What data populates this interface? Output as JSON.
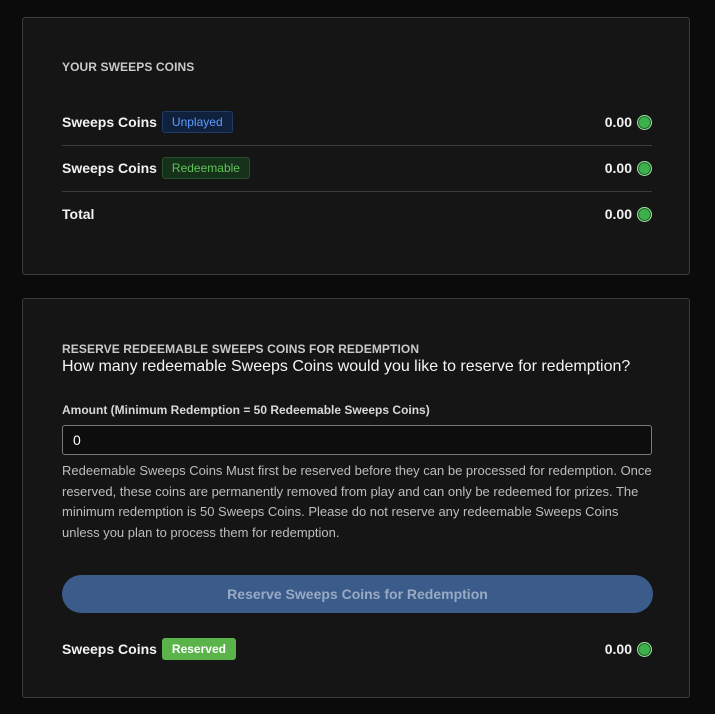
{
  "balances": {
    "title": "YOUR SWEEPS COINS",
    "rows": [
      {
        "label": "Sweeps Coins",
        "badge": "Unplayed",
        "amount": "0.00"
      },
      {
        "label": "Sweeps Coins",
        "badge": "Redeemable",
        "amount": "0.00"
      },
      {
        "label": "Total",
        "amount": "0.00"
      }
    ],
    "coin_color": "#3cb04a"
  },
  "reserve": {
    "title": "RESERVE REDEEMABLE SWEEPS COINS FOR REDEMPTION",
    "question": "How many redeemable Sweeps Coins would you like to reserve for redemption?",
    "amount_label": "Amount (Minimum Redemption = 50 Redeemable Sweeps Coins)",
    "amount_value": "0",
    "help_text": "Redeemable Sweeps Coins Must first be reserved before they can be processed for redemption. Once reserved, these coins are permanently removed from play and can only be redeemed for prizes. The minimum redemption is 50 Sweeps Coins. Please do not reserve any redeemable Sweeps Coins unless you plan to process them for redemption.",
    "button_label": "Reserve Sweeps Coins for Redemption",
    "reserved_row": {
      "label": "Sweeps Coins",
      "badge": "Reserved",
      "amount": "0.00"
    }
  },
  "colors": {
    "accent_blue": "#3b5b8a",
    "badge_unplayed": "#5e9bff",
    "badge_redeemable": "#62c25a",
    "badge_reserved": "#5ab44a"
  }
}
